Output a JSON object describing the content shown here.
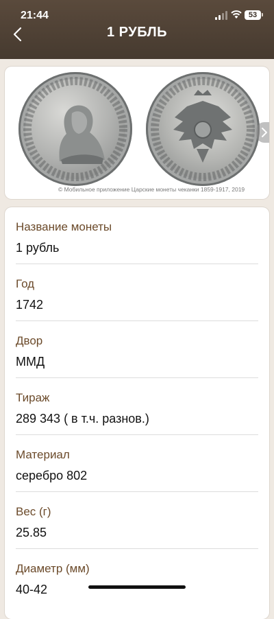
{
  "status_bar": {
    "time": "21:44",
    "battery": "53"
  },
  "header": {
    "title": "1 РУБЛЬ",
    "back_icon": "chevron-left-icon"
  },
  "image": {
    "watermark": "© Мобильное приложение Царские монеты чеканки 1859-1917, 2019",
    "next_icon": "chevron-right-icon"
  },
  "details": [
    {
      "label": "Название монеты",
      "value": "1 рубль"
    },
    {
      "label": "Год",
      "value": "1742"
    },
    {
      "label": "Двор",
      "value": "ММД"
    },
    {
      "label": "Тираж",
      "value": "289 343 ( в т.ч. разнов.)"
    },
    {
      "label": "Материал",
      "value": "серебро 802"
    },
    {
      "label": "Вес (г)",
      "value": "25.85"
    },
    {
      "label": "Диаметр (мм)",
      "value": "40-42"
    }
  ],
  "colors": {
    "header": "#463a2f",
    "label": "#6b4a2a",
    "background": "#efe9e2"
  }
}
